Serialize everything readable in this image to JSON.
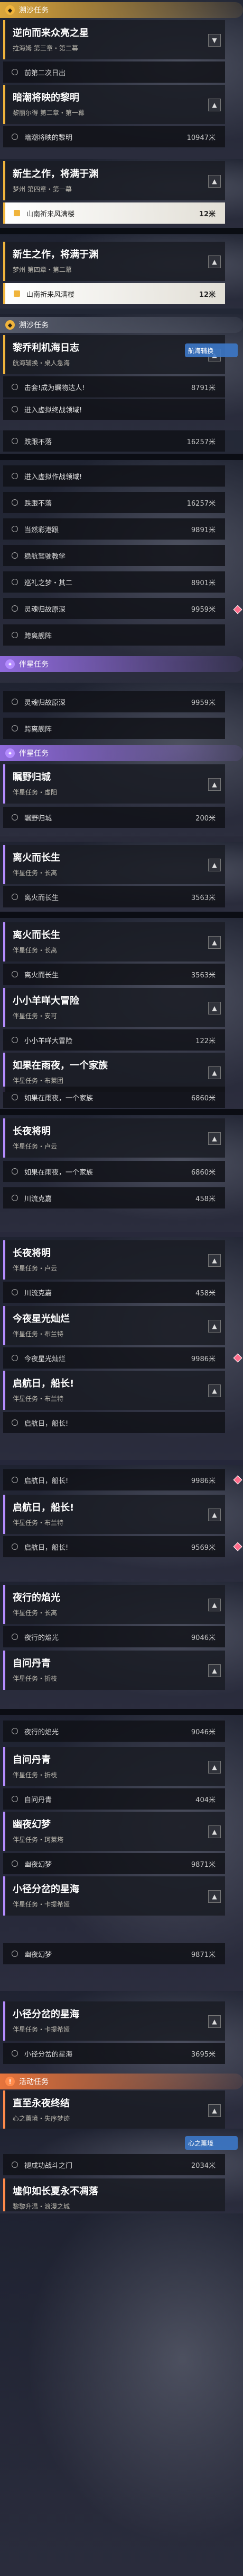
{
  "sections": {
    "trailblaze": "溯沙任务",
    "companion": "伴星任务",
    "event": "活动任务"
  },
  "q": {
    "a": {
      "t": "逆向而来众亮之星",
      "s": "拉海姆 第三章・第二幕"
    },
    "b": {
      "t": "暗潮将映的黎明",
      "s": "黎丽尔得 第二章・第一幕"
    },
    "c": {
      "t": "新生之作，将满于渊",
      "s": "梦州 第四章・第一幕"
    },
    "d": {
      "t": "新生之作，将满于渊",
      "s": "梦州 第四章・第二幕"
    },
    "e": {
      "t": "黎乔利机海日志",
      "s": "航海辅换・桌人急海"
    },
    "f": {
      "t": "瞩野归城",
      "s": "伴星任务・虚阳"
    },
    "g": {
      "t": "离火而长生",
      "s": "伴星任务・长离"
    },
    "h": {
      "t": "离火而长生",
      "s": "伴星任务・长离"
    },
    "i": {
      "t": "小小羊咩大冒险",
      "s": "伴星任务・安可"
    },
    "j": {
      "t": "如果在雨夜，一个家族",
      "s": "伴星任务・布莱团"
    },
    "k": {
      "t": "长夜将明",
      "s": "伴星任务・卢云"
    },
    "l": {
      "t": "长夜将明",
      "s": "伴星任务・卢云"
    },
    "m": {
      "t": "今夜星光灿烂",
      "s": "伴星任务・布兰特"
    },
    "n": {
      "t": "启航日，船长!",
      "s": "伴星任务・布兰特"
    },
    "o": {
      "t": "启航日，船长!",
      "s": "伴星任务・布兰特"
    },
    "p": {
      "t": "夜行的焰光",
      "s": "伴星任务・长离"
    },
    "q": {
      "t": "自问丹青",
      "s": "伴星任务・折枝"
    },
    "r": {
      "t": "自问丹青",
      "s": "伴星任务・折枝"
    },
    "s": {
      "t": "幽夜幻梦",
      "s": "伴星任务・珂莱塔"
    },
    "t": {
      "t": "小径分岔的星海",
      "s": "伴星任务・卡提希娅"
    },
    "u": {
      "t": "小径分岔的星海",
      "s": "伴星任务・卡提希娅"
    },
    "v": {
      "t": "直至永夜终结",
      "s": "心之薰境・失序梦迹"
    },
    "w": {
      "t": "墟仰如长夏永不凋落",
      "s": "黎黎升温・浪漫之城"
    }
  },
  "o": {
    "a1": {
      "l": "前第二次日出",
      "d": ""
    },
    "b1": {
      "l": "暗潮将映的黎明",
      "d": "10947米"
    },
    "c1": {
      "l": "山南祈来风满楼",
      "d": "12米"
    },
    "d1": {
      "l": "山南祈来风满楼",
      "d": "12米"
    },
    "e1": {
      "l": "击套!成为瞩物达人!",
      "d": "8791米"
    },
    "e2": {
      "l": "进入虚拟终战领域!",
      "d": ""
    },
    "e3": {
      "l": "跌跟不落",
      "d": "16257米"
    },
    "x1": {
      "l": "进入虚拟作战领域!",
      "d": ""
    },
    "x2": {
      "l": "跌跟不落",
      "d": "16257米"
    },
    "x3": {
      "l": "当然彩港跟",
      "d": "9891米"
    },
    "x4": {
      "l": "稳航驾驶教学",
      "d": ""
    },
    "x5": {
      "l": "巡礼之梦・其二",
      "d": "8901米"
    },
    "x6": {
      "l": "灵魂归故原深",
      "d": "9959米"
    },
    "x7": {
      "l": "跨离舰阵",
      "d": ""
    },
    "y1": {
      "l": "灵魂归故原深",
      "d": "9959米"
    },
    "y2": {
      "l": "跨离舰阵",
      "d": ""
    },
    "f1": {
      "l": "瞩野归城",
      "d": "200米"
    },
    "g1": {
      "l": "离火而长生",
      "d": "3563米"
    },
    "h1": {
      "l": "离火而长生",
      "d": "3563米"
    },
    "i1": {
      "l": "小小羊咩大冒险",
      "d": "122米"
    },
    "j1": {
      "l": "如果在雨夜，一个家族",
      "d": "6860米"
    },
    "k1": {
      "l": "如果在雨夜，一个家族",
      "d": "6860米"
    },
    "k2": {
      "l": "川流克嘉",
      "d": "458米"
    },
    "l1": {
      "l": "川流克嘉",
      "d": "458米"
    },
    "m1": {
      "l": "今夜星光灿烂",
      "d": "9986米"
    },
    "m2": {
      "l": "启航日，船长!",
      "d": ""
    },
    "n1": {
      "l": "启航日，船长!",
      "d": "9986米"
    },
    "o1": {
      "l": "启航日，船长!",
      "d": "9569米"
    },
    "p1": {
      "l": "夜行的焰光",
      "d": "9046米"
    },
    "p2": {
      "l": "夜行的焰光",
      "d": "9046米"
    },
    "q1": {
      "l": "自问丹青",
      "d": "404米"
    },
    "r1": {
      "l": "自问丹青",
      "d": "404米"
    },
    "s1": {
      "l": "幽夜幻梦",
      "d": "9871米"
    },
    "s2": {
      "l": "幽夜幻梦",
      "d": "9871米"
    },
    "t1": {
      "l": "小径分岔的星海",
      "d": "3695米"
    },
    "v1": {
      "l": "褪成功战斗之门",
      "d": "2034米"
    }
  },
  "tooltips": {
    "a": "航海辅换",
    "b": "心之薰境"
  }
}
